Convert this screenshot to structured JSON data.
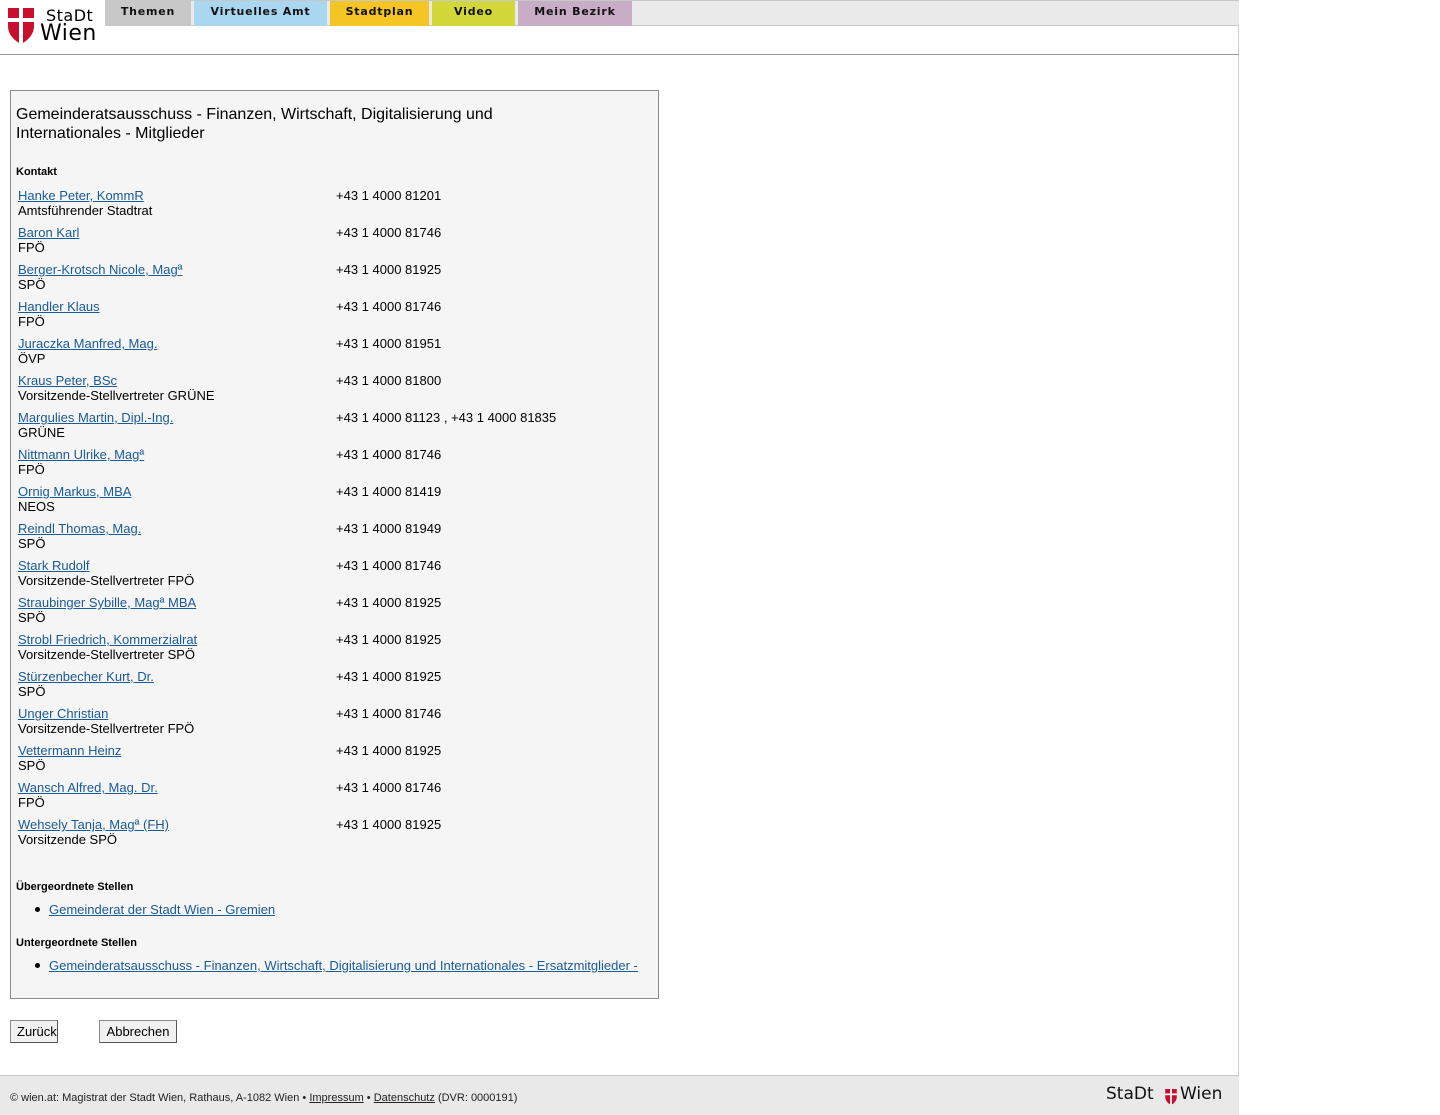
{
  "brand": {
    "stadt": "StaDt",
    "wien": "Wien",
    "shield_color": "#c8102e"
  },
  "nav": {
    "tabs": [
      {
        "label": "Themen",
        "color": "#c8c8c8"
      },
      {
        "label": "Virtuelles Amt",
        "color": "#a9d6f0"
      },
      {
        "label": "Stadtplan",
        "color": "#f5c425"
      },
      {
        "label": "Video",
        "color": "#d2d83a"
      },
      {
        "label": "Mein Bezirk",
        "color": "#c9adc6"
      }
    ]
  },
  "panel": {
    "title": "Gemeinderatsausschuss - Finanzen, Wirtschaft, Digitalisierung und Internationales - Mitglieder",
    "contact_heading": "Kontakt",
    "members": [
      {
        "name": "Hanke Peter, KommR",
        "role": "Amtsführender Stadtrat",
        "phone": "+43 1 4000 81201"
      },
      {
        "name": "Baron Karl",
        "role": "FPÖ",
        "phone": "+43 1 4000 81746"
      },
      {
        "name": "Berger-Krotsch Nicole, Magª",
        "role": "SPÖ",
        "phone": "+43 1 4000 81925"
      },
      {
        "name": "Handler Klaus",
        "role": "FPÖ",
        "phone": "+43 1 4000 81746"
      },
      {
        "name": "Juraczka Manfred, Mag.",
        "role": "ÖVP",
        "phone": "+43 1 4000 81951"
      },
      {
        "name": "Kraus Peter, BSc",
        "role": "Vorsitzende-Stellvertreter GRÜNE",
        "phone": "+43 1 4000 81800"
      },
      {
        "name": "Margulies Martin, Dipl.-Ing.",
        "role": "GRÜNE",
        "phone": "+43 1 4000 81123 , +43 1 4000 81835"
      },
      {
        "name": "Nittmann Ulrike, Magª",
        "role": "FPÖ",
        "phone": "+43 1 4000 81746"
      },
      {
        "name": "Ornig Markus, MBA",
        "role": "NEOS",
        "phone": "+43 1 4000 81419"
      },
      {
        "name": "Reindl Thomas, Mag.",
        "role": "SPÖ",
        "phone": "+43 1 4000 81949"
      },
      {
        "name": "Stark Rudolf",
        "role": "Vorsitzende-Stellvertreter FPÖ",
        "phone": "+43 1 4000 81746"
      },
      {
        "name": "Straubinger Sybille, Magª MBA",
        "role": "SPÖ",
        "phone": "+43 1 4000 81925"
      },
      {
        "name": "Strobl Friedrich, Kommerzialrat",
        "role": "Vorsitzende-Stellvertreter SPÖ",
        "phone": "+43 1 4000 81925"
      },
      {
        "name": "Stürzenbecher Kurt, Dr.",
        "role": "SPÖ",
        "phone": "+43 1 4000 81925"
      },
      {
        "name": "Unger Christian",
        "role": "Vorsitzende-Stellvertreter FPÖ",
        "phone": "+43 1 4000 81746"
      },
      {
        "name": "Vettermann Heinz",
        "role": "SPÖ",
        "phone": "+43 1 4000 81925"
      },
      {
        "name": "Wansch Alfred, Mag. Dr.",
        "role": "FPÖ",
        "phone": "+43 1 4000 81746"
      },
      {
        "name": "Wehsely Tanja, Magª (FH)",
        "role": "Vorsitzende SPÖ",
        "phone": "+43 1 4000 81925"
      }
    ],
    "superior_heading": "Übergeordnete Stellen",
    "superior_links": [
      "Gemeinderat der Stadt Wien - Gremien"
    ],
    "subordinate_heading": "Untergeordnete Stellen",
    "subordinate_links": [
      "Gemeinderatsausschuss - Finanzen, Wirtschaft, Digitalisierung und Internationales - Ersatzmitglieder -"
    ]
  },
  "buttons": {
    "back": "Zurück",
    "cancel": "Abbrechen"
  },
  "footer": {
    "prefix": "© wien.at: Magistrat der Stadt Wien, Rathaus, A-1082 Wien •",
    "impressum": "Impressum",
    "separator": "•",
    "datenschutz": "Datenschutz",
    "dvr": "(DVR: 0000191)",
    "logo_stadt": "StaDt",
    "logo_wien": "Wien"
  }
}
